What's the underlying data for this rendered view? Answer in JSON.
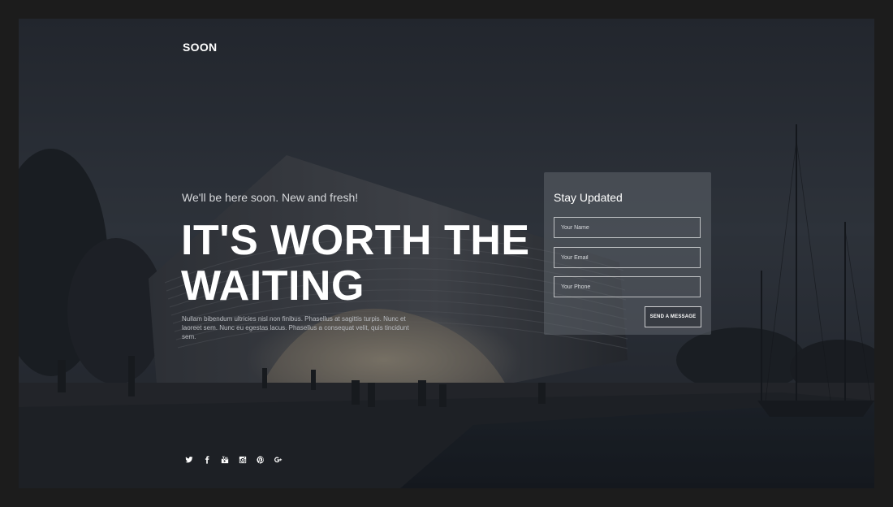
{
  "brand": {
    "logo": "SOON"
  },
  "hero": {
    "tagline": "We'll be here soon. New and fresh!",
    "headline_line1": "IT'S WORTH THE",
    "headline_line2": "WAITING",
    "description": "Nullam bibendum ultricies nisl non finibus. Phasellus at sagittis turpis. Nunc et laoreet sem. Nunc eu egestas lacus. Phasellus a consequat velit, quis tincidunt sem."
  },
  "subscribe": {
    "title": "Stay Updated",
    "name_placeholder": "Your Name",
    "email_placeholder": "Your Email",
    "phone_placeholder": "Your Phone",
    "submit_label": "SEND A MESSAGE"
  },
  "social": [
    "twitter-icon",
    "facebook-icon",
    "youtube-icon",
    "instagram-icon",
    "pinterest-icon",
    "google-plus-icon"
  ],
  "colors": {
    "text": "#ffffff",
    "panel": "#5f646c",
    "background": "#1c1c1c"
  }
}
